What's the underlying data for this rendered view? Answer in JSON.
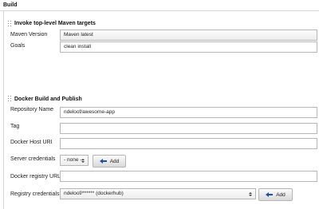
{
  "build": {
    "title": "Build",
    "maven": {
      "title": "Invoke top-level Maven targets",
      "version_label": "Maven Version",
      "version_value": "Maven latest",
      "goals_label": "Goals",
      "goals_value": "clean install"
    },
    "docker": {
      "title": "Docker Build and Publish",
      "repo_label": "Repository Name",
      "repo_value": "ndeloof/awesome-app",
      "tag_label": "Tag",
      "tag_value": "",
      "host_label": "Docker Host URI",
      "host_value": "",
      "server_cred_label": "Server credentials",
      "server_cred_value": "- none -",
      "registry_url_label": "Docker registry URL",
      "registry_url_value": "",
      "registry_cred_label": "Registry credentials",
      "registry_cred_value": "ndeloof/****** (dockerhub)",
      "add_label": "Add"
    }
  }
}
